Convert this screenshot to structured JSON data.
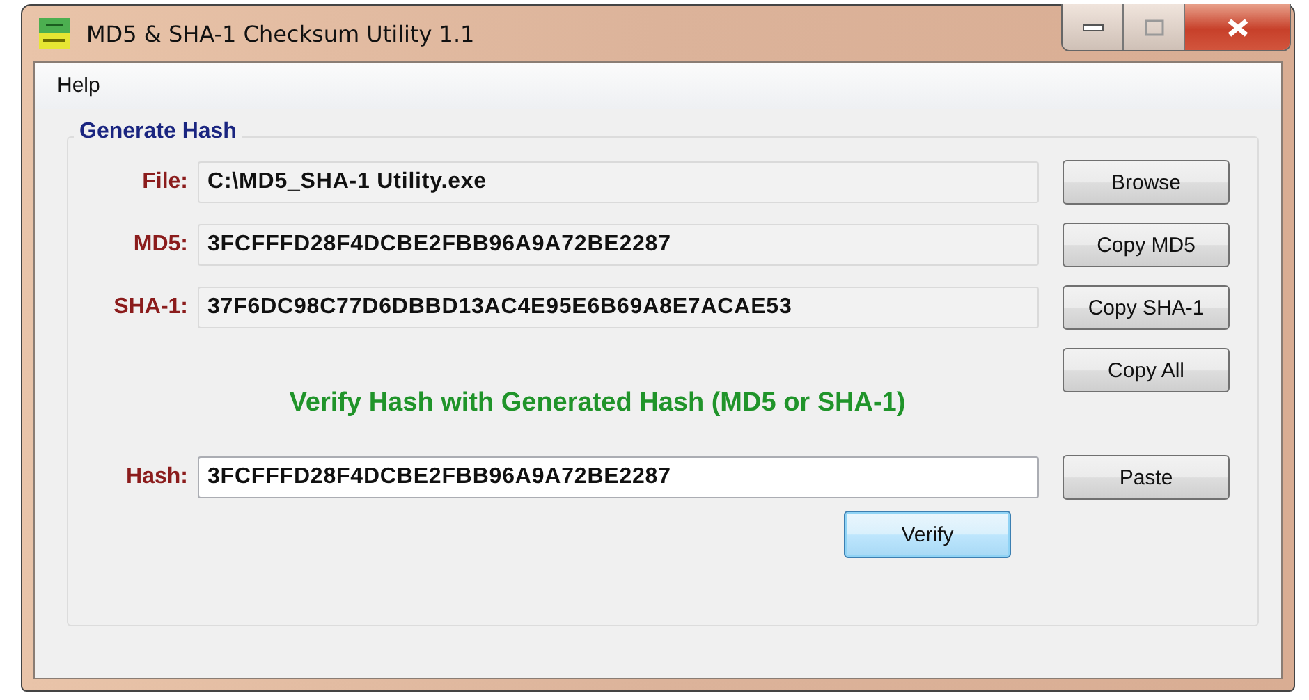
{
  "window": {
    "title": "MD5 & SHA-1 Checksum Utility 1.1"
  },
  "menu": [
    "Help"
  ],
  "generate_group": {
    "title": "Generate Hash",
    "rows": [
      {
        "label": "File:",
        "value": "C:\\MD5_SHA-1 Utility.exe",
        "readonly": true,
        "button": "Browse"
      },
      {
        "label": "MD5:",
        "value": "3FCFFFD28F4DCBE2FBB96A9A72BE2287",
        "readonly": true,
        "button": "Copy MD5"
      },
      {
        "label": "SHA-1:",
        "value": "37F6DC98C77D6DBBD13AC4E95E6B69A8E7ACAE53",
        "readonly": true,
        "button": "Copy SHA-1"
      }
    ],
    "copy_all_button": "Copy All"
  },
  "verify": {
    "title": "Verify Hash with Generated Hash (MD5 or SHA-1)",
    "row": {
      "label": "Hash:",
      "value": "3FCFFFD28F4DCBE2FBB96A9A72BE2287",
      "readonly": false,
      "button": "Paste"
    },
    "verify_button": {
      "label": "Verify",
      "default": true
    }
  }
}
